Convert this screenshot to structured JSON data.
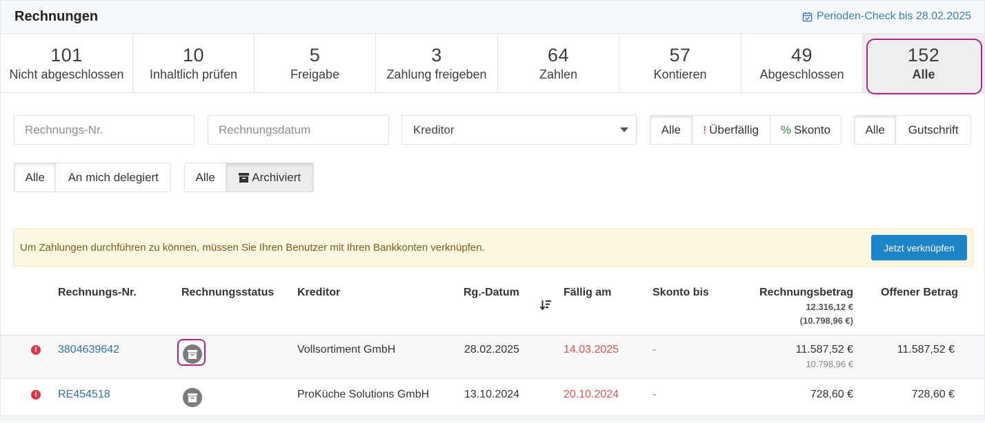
{
  "header": {
    "title": "Rechnungen",
    "period_check": "Perioden-Check bis 28.02.2025",
    "period_icon": "calendar-check-icon"
  },
  "stages": [
    {
      "count": "101",
      "label": "Nicht abgeschlossen"
    },
    {
      "count": "10",
      "label": "Inhaltlich prüfen"
    },
    {
      "count": "5",
      "label": "Freigabe"
    },
    {
      "count": "3",
      "label": "Zahlung freigeben"
    },
    {
      "count": "64",
      "label": "Zahlen"
    },
    {
      "count": "57",
      "label": "Kontieren"
    },
    {
      "count": "49",
      "label": "Abgeschlossen"
    },
    {
      "count": "152",
      "label": "Alle",
      "active": true
    }
  ],
  "filters": {
    "invoice_no_placeholder": "Rechnungs-Nr.",
    "invoice_date_placeholder": "Rechnungsdatum",
    "creditor_select": "Kreditor",
    "due_group": {
      "all": "Alle",
      "overdue_mark": "!",
      "overdue": "Überfällig",
      "discount_mark": "%",
      "discount": "Skonto",
      "selected": "Alle"
    },
    "type_group": {
      "all": "Alle",
      "credit": "Gutschrift",
      "selected": "Alle"
    },
    "delegate_group": {
      "all": "Alle",
      "delegated": "An mich delegiert",
      "selected": "Alle"
    },
    "archive_group": {
      "all": "Alle",
      "archived": "Archiviert",
      "archive_icon": "archive-box-icon",
      "selected": "Archiviert"
    }
  },
  "alert": {
    "text": "Um Zahlungen durchführen zu können, müssen Sie Ihren Benutzer mit Ihren Bankkonten verknüpfen.",
    "button": "Jetzt verknüpfen"
  },
  "table": {
    "columns": {
      "invoice_no": "Rechnungs-Nr.",
      "status": "Rechnungsstatus",
      "creditor": "Kreditor",
      "date": "Rg.-Datum",
      "sort_icon": "sort-descending-icon",
      "due": "Fällig am",
      "discount_until": "Skonto bis",
      "amount": "Rechnungsbetrag",
      "amount_total": "12.316,12 €",
      "amount_total_net": "(10.798,96 €)",
      "open": "Offener Betrag"
    },
    "rows": [
      {
        "warning_icon": "exclamation-circle-icon",
        "invoice_no": "3804639642",
        "status_icon": "archive-icon",
        "creditor": "Vollsortiment GmbH",
        "date": "28.02.2025",
        "due": "14.03.2025",
        "discount_until": "-",
        "amount": "11.587,52 €",
        "amount_net": "10.798,96 €",
        "open": "11.587,52 €"
      },
      {
        "warning_icon": "exclamation-circle-icon",
        "invoice_no": "RE454518",
        "status_icon": "archive-icon",
        "creditor": "ProKüche Solutions GmbH",
        "date": "13.10.2024",
        "due": "20.10.2024",
        "discount_until": "-",
        "amount": "728,60 €",
        "amount_net": "",
        "open": "728,60 €"
      }
    ]
  },
  "colors": {
    "highlight": "#b0208f",
    "link": "#2f72ab",
    "overdue": "#d9534f",
    "primary_button": "#1e84c8"
  }
}
